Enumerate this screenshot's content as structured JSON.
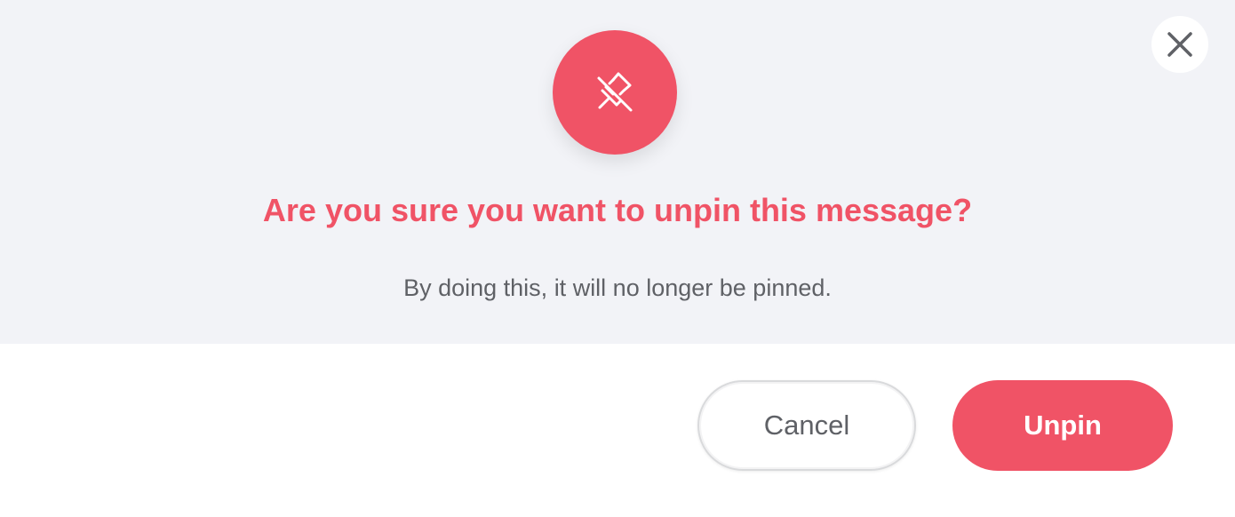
{
  "dialog": {
    "icon": "unpin-icon",
    "title": "Are you sure you want to unpin this message?",
    "subtitle": "By doing this, it will no longer be pinned.",
    "close_icon": "close-icon",
    "cancel_label": "Cancel",
    "confirm_label": "Unpin"
  },
  "colors": {
    "accent": "#f05366",
    "top_background": "#f2f3f7",
    "body_text": "#5f6166",
    "close_icon": "#5f6166"
  }
}
